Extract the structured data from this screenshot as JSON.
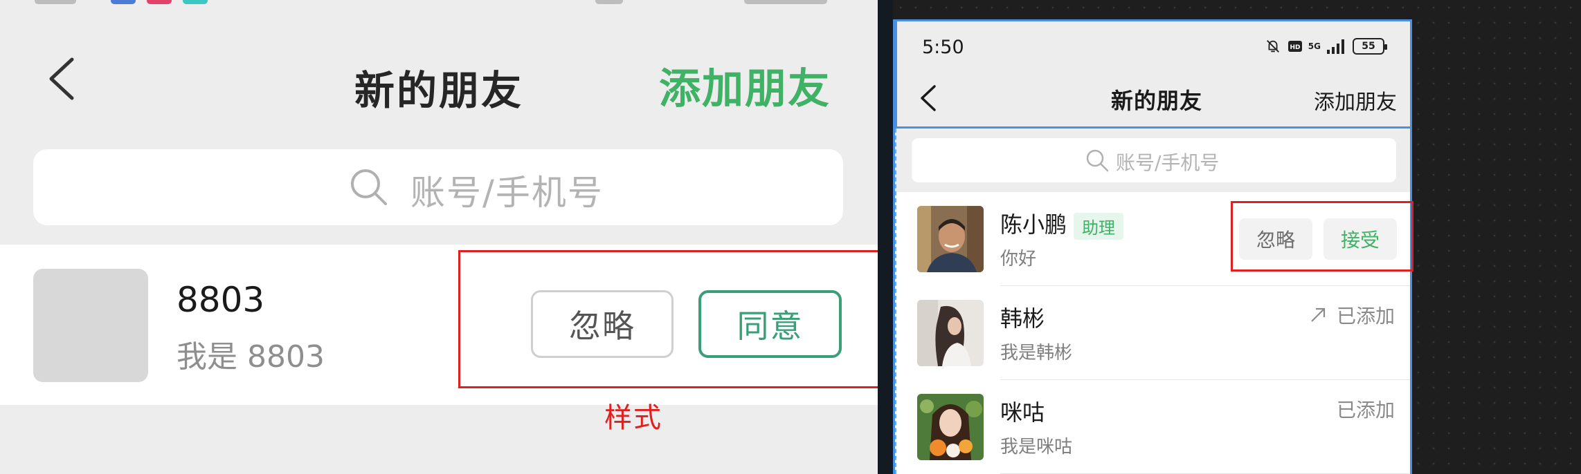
{
  "reference_panel": {
    "title": "新的朋友",
    "add_friend_label": "添加朋友",
    "search_placeholder": "账号/手机号",
    "contact": {
      "name": "8803",
      "message": "我是 8803"
    },
    "ignore_label": "忽略",
    "agree_label": "同意",
    "annotation_label": "样式",
    "colors": {
      "accent_green": "#3fb266",
      "agree_green": "#3a9e77",
      "annotation_red": "#e02020"
    }
  },
  "phone_panel": {
    "status_bar": {
      "time": "5:50",
      "network_label": "5G",
      "battery_level": "55",
      "icons": [
        "mute-icon",
        "hd-icon",
        "signal-icon",
        "battery-icon"
      ]
    },
    "title": "新的朋友",
    "add_friend_label": "添加朋友",
    "search_placeholder": "账号/手机号",
    "contacts": [
      {
        "name": "陈小鹏",
        "tag": "助理",
        "message": "你好",
        "ignore_label": "忽略",
        "accept_label": "接受"
      },
      {
        "name": "韩彬",
        "message": "我是韩彬",
        "status": "已添加"
      },
      {
        "name": "咪咕",
        "message": "我是咪咕",
        "status": "已添加"
      }
    ],
    "colors": {
      "accent_green": "#3fb266",
      "selection_blue": "#4a90e2"
    }
  }
}
